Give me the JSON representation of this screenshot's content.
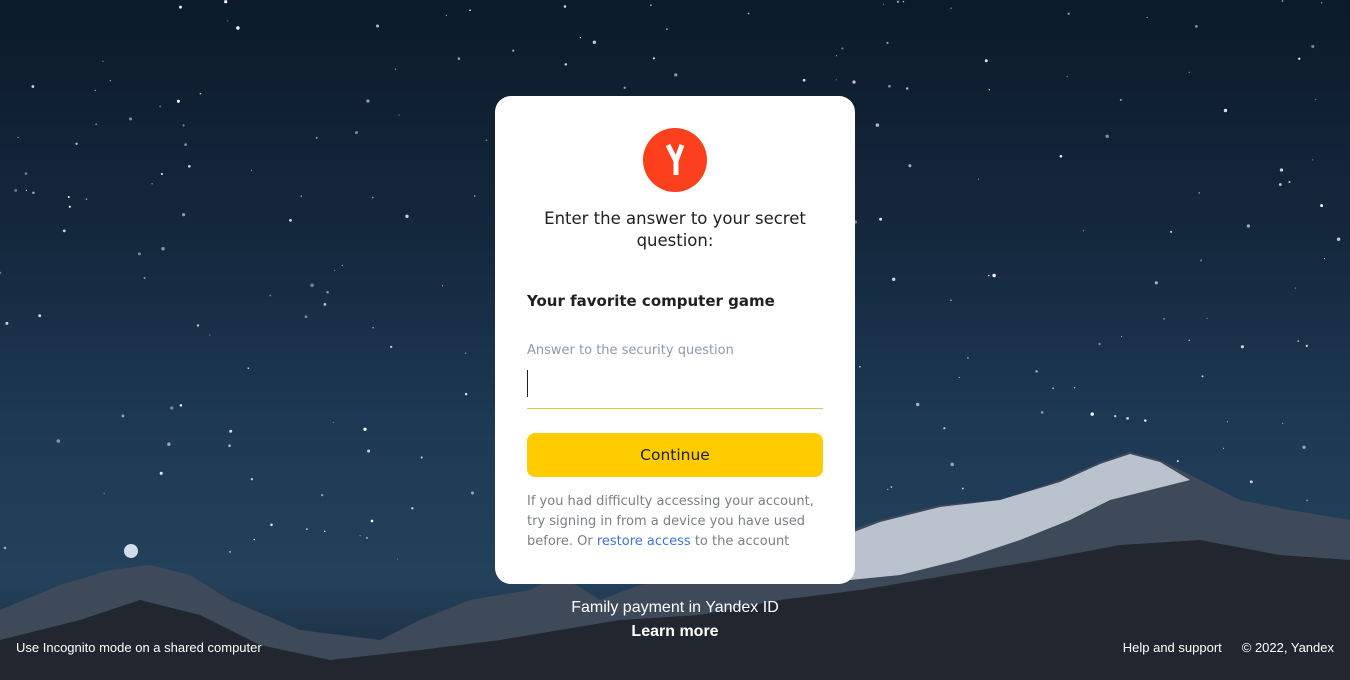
{
  "card": {
    "logo_icon": "yandex-logo",
    "title": "Enter the answer to your secret question:",
    "question": "Your favorite computer game",
    "answer_label": "Answer to the security question",
    "answer_value": "",
    "continue_label": "Continue",
    "hint_prefix": "If you had difficulty accessing your account, try signing in from a device you have used before. Or ",
    "hint_link": "restore access",
    "hint_suffix": " to the account"
  },
  "promo": {
    "line1": "Family payment in Yandex ID",
    "link": "Learn more"
  },
  "footer": {
    "left": "Use Incognito mode on a shared computer",
    "help": "Help and support",
    "copyright": "© 2022, Yandex"
  },
  "colors": {
    "accent_button": "#ffcc00",
    "logo_red": "#fc3f1d",
    "link_blue": "#3f72d8"
  }
}
